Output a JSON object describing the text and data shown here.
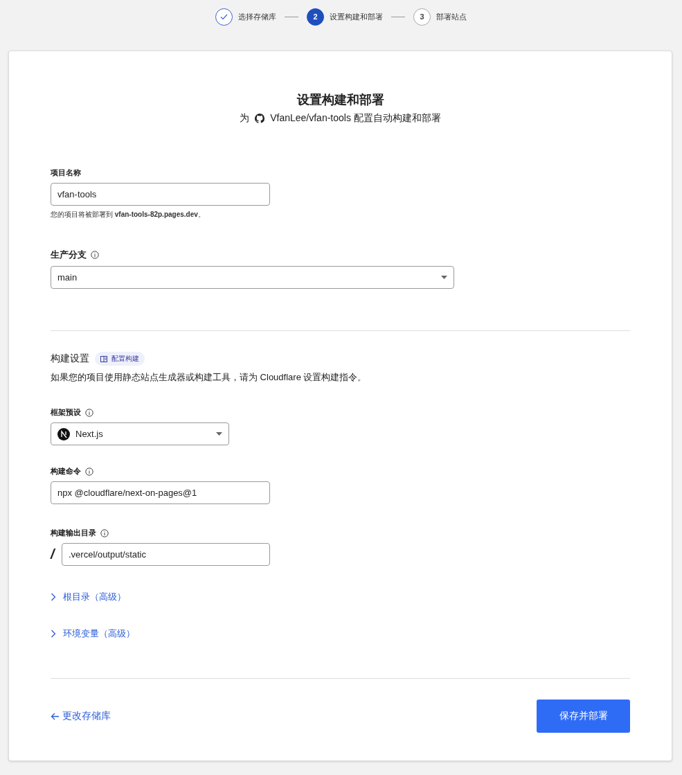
{
  "steps": [
    {
      "completed": true,
      "selected": false,
      "label": "选择存储库"
    },
    {
      "completed": false,
      "selected": true,
      "number": "2",
      "label": "设置构建和部署"
    },
    {
      "completed": false,
      "selected": false,
      "number": "3",
      "label": "部署站点"
    }
  ],
  "header": {
    "title": "设置构建和部署",
    "subtitle_prefix": "为",
    "repo_subtitle": "VfanLee/vfan-tools 配置自动构建和部署"
  },
  "project_name": {
    "label": "项目名称",
    "value": "vfan-tools",
    "hint": "您的项目将被部署到 **vfan-tools-82p.pages.dev**。"
  },
  "production_branch": {
    "label": "生产分支",
    "value": "main"
  },
  "build_settings": {
    "title": "构建设置",
    "badge": "配置构建",
    "description": "如果您的项目使用静态站点生成器或构建工具，请为 Cloudflare 设置构建指令。"
  },
  "framework_preset": {
    "label": "框架预设",
    "value": "Next.js"
  },
  "build_command": {
    "label": "构建命令",
    "value": "npx @cloudflare/next-on-pages@1"
  },
  "build_output": {
    "label": "构建输出目录",
    "prefix": "/",
    "value": ".vercel/output/static"
  },
  "advanced": [
    {
      "label": "根目录（高级）",
      "expanded": false
    },
    {
      "label": "环境变量（高级）",
      "expanded": false
    }
  ],
  "footer": {
    "back_link": "更改存储库",
    "submit": "保存并部署"
  }
}
